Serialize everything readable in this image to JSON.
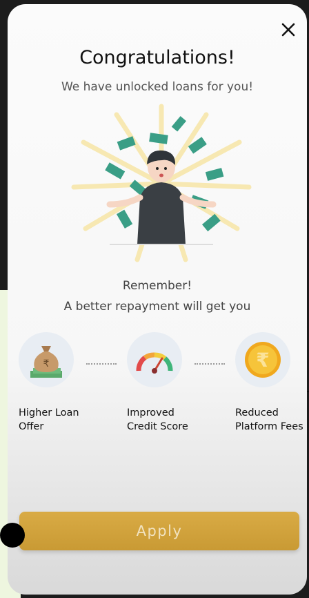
{
  "modal": {
    "title": "Congratulations!",
    "subtitle": "We have unlocked loans for you!",
    "remember": "Remember!",
    "repayment_text": "A better repayment will get you",
    "apply_label": "Apply"
  },
  "benefits": [
    {
      "line1": "Higher Loan",
      "line2": "Offer",
      "icon": "money-bag-icon"
    },
    {
      "line1": "Improved",
      "line2": "Credit Score",
      "icon": "credit-gauge-icon"
    },
    {
      "line1": "Reduced",
      "line2": "Platform Fees",
      "icon": "rupee-coin-icon"
    }
  ],
  "colors": {
    "accent": "#d4a53f",
    "money_green": "#3a9e86",
    "icon_bg": "#e8edf3"
  }
}
